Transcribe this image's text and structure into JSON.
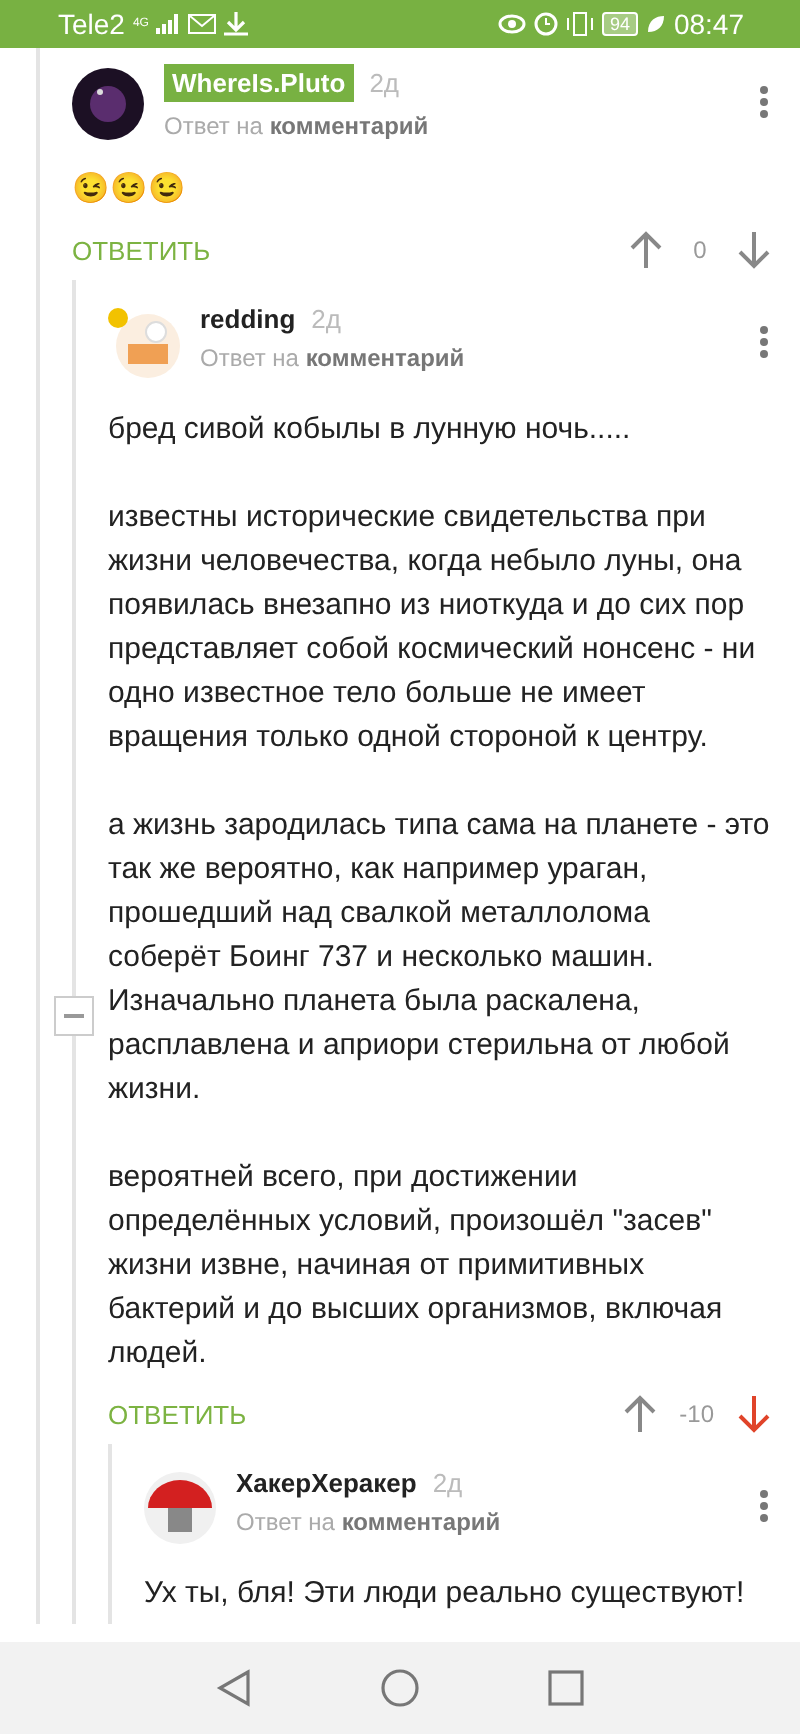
{
  "status_bar": {
    "carrier": "Tele2",
    "network": "4G",
    "battery": "94",
    "time": "08:47"
  },
  "comments": [
    {
      "author": "WhereIs.Pluto",
      "author_highlighted": true,
      "age": "2д",
      "reply_prefix": "Ответ на",
      "reply_target": "комментарий",
      "paragraphs": [
        "😉😉😉"
      ],
      "reply_label": "ОТВЕТИТЬ",
      "score": "0",
      "downvoted": false,
      "collapsible": false,
      "children": [
        {
          "author": "redding",
          "author_highlighted": false,
          "age": "2д",
          "reply_prefix": "Ответ на",
          "reply_target": "комментарий",
          "paragraphs": [
            "бред сивой кобылы в лунную ночь.....",
            "известны исторические свидетельства при жизни человечества, когда небыло луны, она появилась внезапно из ниоткуда и до сих пор представляет собой космический нонсенс - ни одно известное тело больше не имеет вращения только одной стороной к центру.",
            "а жизнь зародилась типа сама на планете - это так же вероятно, как например ураган, прошедший над свалкой металлолома соберёт Боинг 737 и несколько машин. Изначально планета была раскалена, расплавлена и априори стерильна от любой жизни.",
            "вероятней всего, при достижении определённых условий, произошёл \"засев\" жизни извне, начиная от примитивных бактерий и до высших организмов, включая людей."
          ],
          "reply_label": "ОТВЕТИТЬ",
          "score": "-10",
          "downvoted": true,
          "collapsible": true,
          "children": [
            {
              "author": "ХакерХеракер",
              "author_highlighted": false,
              "age": "2д",
              "reply_prefix": "Ответ на",
              "reply_target": "комментарий",
              "paragraphs": [
                "Ух ты, бля! Эти люди реально существуют!"
              ],
              "collapsible": false
            }
          ]
        }
      ]
    }
  ]
}
